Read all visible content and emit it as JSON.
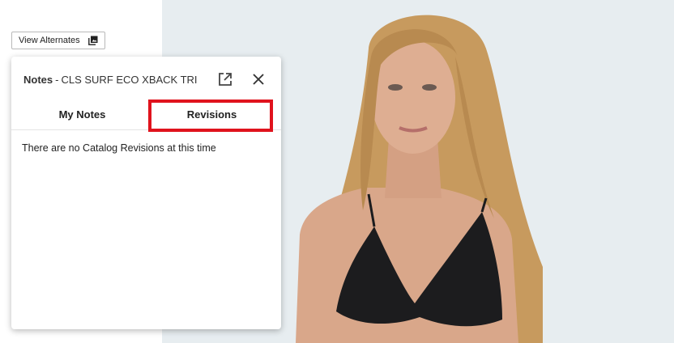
{
  "toolbar": {
    "view_alternates_label": "View Alternates"
  },
  "notes_panel": {
    "title_prefix": "Notes",
    "title_separator": "-",
    "product_name": "CLS SURF ECO XBACK TRI",
    "tabs": [
      {
        "label": "My Notes",
        "active": false
      },
      {
        "label": "Revisions",
        "active": true
      }
    ],
    "empty_message": "There are no Catalog Revisions at this time",
    "highlight_color": "#e0131d"
  },
  "icons": {
    "view_alternates": "image-stack-icon",
    "popout": "open-in-new-icon",
    "close": "close-icon"
  }
}
